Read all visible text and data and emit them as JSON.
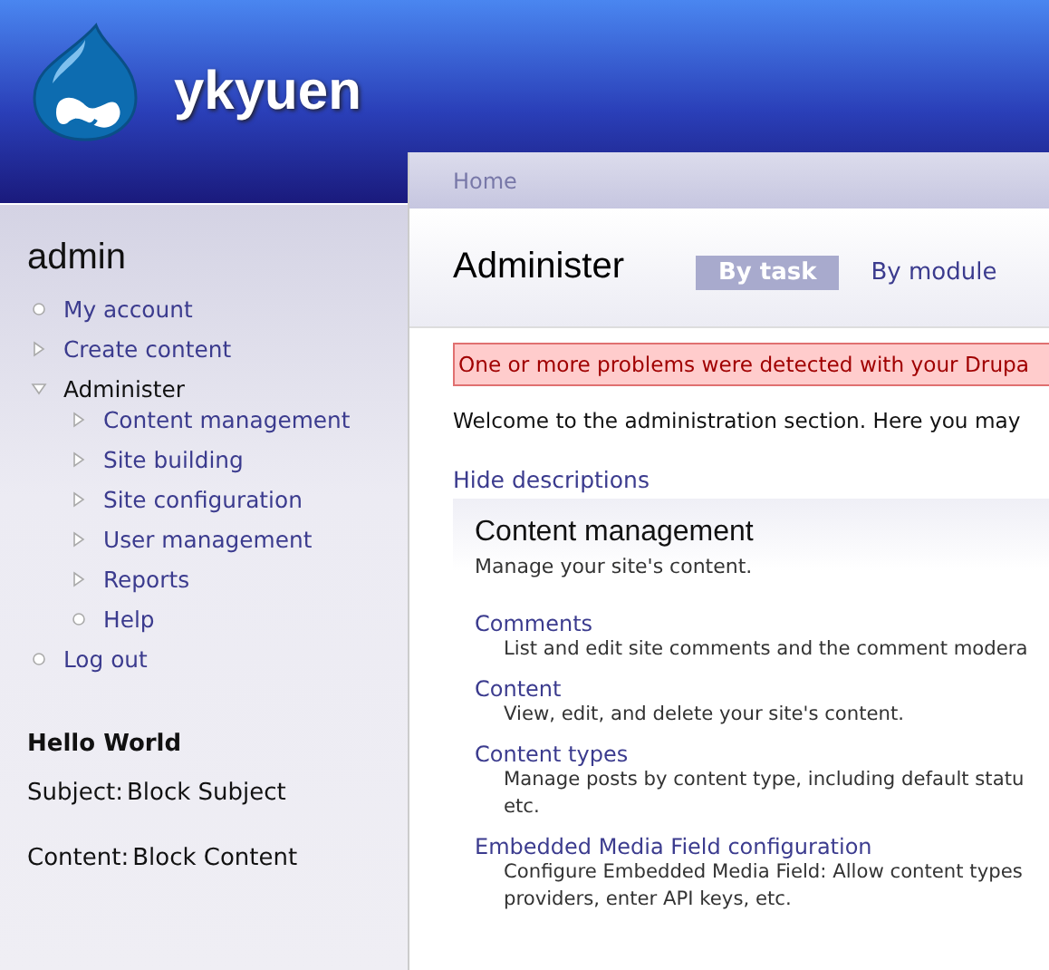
{
  "site_name": "ykyuen",
  "breadcrumb": [
    "Home"
  ],
  "sidebar": {
    "title": "admin",
    "menu": [
      {
        "label": "My account",
        "kind": "leaf"
      },
      {
        "label": "Create content",
        "kind": "branch",
        "expanded": false
      },
      {
        "label": "Administer",
        "kind": "branch",
        "expanded": true,
        "children": [
          {
            "label": "Content management",
            "kind": "branch",
            "expanded": false
          },
          {
            "label": "Site building",
            "kind": "branch",
            "expanded": false
          },
          {
            "label": "Site configuration",
            "kind": "branch",
            "expanded": false
          },
          {
            "label": "User management",
            "kind": "branch",
            "expanded": false
          },
          {
            "label": "Reports",
            "kind": "branch",
            "expanded": false
          },
          {
            "label": "Help",
            "kind": "leaf"
          }
        ]
      },
      {
        "label": "Log out",
        "kind": "leaf"
      }
    ],
    "block": {
      "title": "Hello World",
      "fields": [
        {
          "label": "Subject:",
          "value": "Block Subject"
        },
        {
          "label": "Content:",
          "value": "Block Content"
        }
      ]
    }
  },
  "page": {
    "title": "Administer",
    "tabs": [
      {
        "label": "By task",
        "selected": true
      },
      {
        "label": "By module",
        "selected": false
      }
    ],
    "error": "One or more problems were detected with your Drupa",
    "intro": "Welcome to the administration section. Here you may",
    "toggle": "Hide descriptions",
    "section": {
      "title": "Content management",
      "description": "Manage your site's content.",
      "items": [
        {
          "label": "Comments",
          "lines": [
            "List and edit site comments and the comment modera"
          ]
        },
        {
          "label": "Content",
          "lines": [
            "View, edit, and delete your site's content."
          ]
        },
        {
          "label": "Content types",
          "lines": [
            "Manage posts by content type, including default statu",
            "etc."
          ]
        },
        {
          "label": "Embedded Media Field configuration",
          "lines": [
            "Configure Embedded Media Field: Allow content types",
            "providers, enter API keys, etc."
          ]
        }
      ]
    }
  }
}
